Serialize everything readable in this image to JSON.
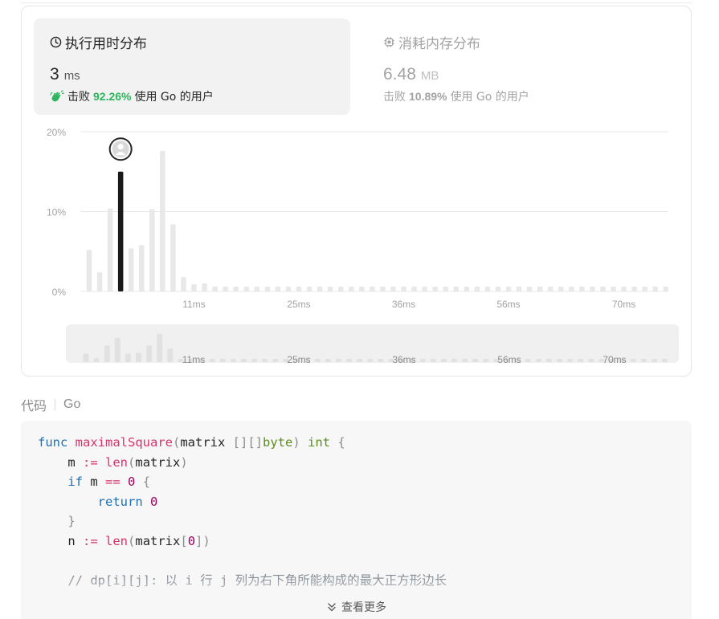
{
  "runtime": {
    "title": "执行用时分布",
    "value": "3",
    "unit": "ms",
    "beat_prefix": "击败",
    "beat_pct": "92.26%",
    "beat_suffix": "使用 Go 的用户",
    "icon": "clock-icon"
  },
  "memory": {
    "title": "消耗内存分布",
    "value": "6.48",
    "unit": "MB",
    "beat_prefix": "击败",
    "beat_pct": "10.89%",
    "beat_suffix": "使用 Go 的用户",
    "icon": "chip-icon"
  },
  "colors": {
    "accent_green": "#2db55d",
    "bar_default": "#e8e8e8",
    "bar_active": "#1a1a1a",
    "grid": "#e8e8e8"
  },
  "chart_data": {
    "type": "bar",
    "y_ticks": [
      "20%",
      "10%",
      "0%"
    ],
    "ylim": [
      0,
      20
    ],
    "x_labels": [
      "11ms",
      "25ms",
      "36ms",
      "56ms",
      "70ms"
    ],
    "active_index": 3,
    "values": [
      5.2,
      2.4,
      10.4,
      15,
      5.4,
      5.8,
      10.3,
      17.6,
      8.4,
      1.8,
      0.9,
      1.0,
      0.6,
      0.6,
      0.6,
      0.6,
      0.6,
      0.6,
      0.6,
      0.6,
      0.6,
      0.6,
      0.6,
      0.6,
      0.6,
      0.6,
      0.6,
      0.6,
      0.6,
      0.6,
      0.6,
      0.6,
      0.6,
      0.6,
      0.6,
      0.6,
      0.6,
      0.6,
      0.6,
      0.6,
      0.6,
      0.6,
      0.6,
      0.6,
      0.6,
      0.6,
      0.6,
      0.6,
      0.6,
      0.6,
      0.6,
      0.6,
      0.6,
      0.6,
      0.6,
      0.6
    ],
    "overview_x_labels": [
      "11ms",
      "25ms",
      "36ms",
      "56ms",
      "70ms"
    ],
    "marker": "avatar"
  },
  "code_section": {
    "label": "代码",
    "language": "Go",
    "lines": [
      "func maximalSquare(matrix [][]byte) int {",
      "    m := len(matrix)",
      "    if m == 0 {",
      "        return 0",
      "    }",
      "    n := len(matrix[0])",
      "",
      "    // dp[i][j]: 以 i 行 j 列为右下角所能构成的最大正方形边长"
    ],
    "show_more": "查看更多"
  }
}
